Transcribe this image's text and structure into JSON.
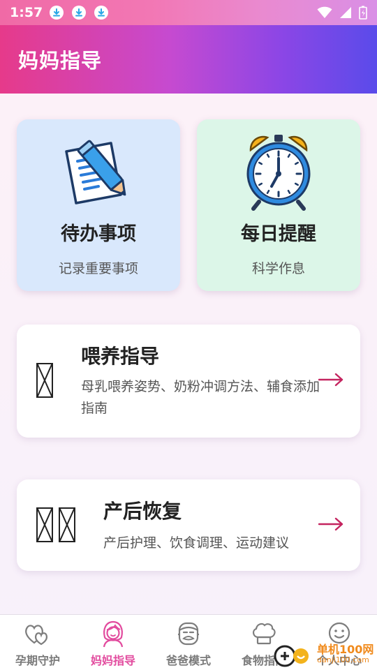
{
  "status_bar": {
    "time": "1:57",
    "download_icons": [
      "download-icon",
      "download-icon",
      "download-icon"
    ],
    "indicators": [
      "wifi-icon",
      "signal-icon",
      "battery-icon"
    ]
  },
  "app_bar": {
    "title": "妈妈指导"
  },
  "cards": {
    "todo": {
      "title": "待办事项",
      "subtitle": "记录重要事项",
      "icon": "notepad-pencil-icon"
    },
    "reminder": {
      "title": "每日提醒",
      "subtitle": "科学作息",
      "icon": "alarm-clock-icon"
    }
  },
  "sections": {
    "feeding": {
      "title": "喂养指导",
      "description": "母乳喂养姿势、奶粉冲调方法、辅食添加指南",
      "icon": "missing-glyph-icon"
    },
    "recovery": {
      "title": "产后恢复",
      "description": "产后护理、饮食调理、运动建议",
      "icon": "missing-glyph-icon"
    }
  },
  "bottom_nav": {
    "items": [
      {
        "label": "孕期守护",
        "icon": "hearts-icon",
        "active": false
      },
      {
        "label": "妈妈指导",
        "icon": "mother-icon",
        "active": true
      },
      {
        "label": "爸爸模式",
        "icon": "father-icon",
        "active": false
      },
      {
        "label": "食物指南",
        "icon": "chef-hat-icon",
        "active": false
      },
      {
        "label": "个人中心",
        "icon": "smiley-icon",
        "active": false
      }
    ]
  },
  "watermark": {
    "name": "单机100网",
    "url": "danji100.com"
  },
  "colors": {
    "accent": "#e24b9e",
    "app_bar_start": "#e63a8a",
    "app_bar_end": "#5a4bea",
    "todo_card": "#d9e8fc",
    "reminder_card": "#dcf6e8",
    "arrow": "#c4245f"
  }
}
